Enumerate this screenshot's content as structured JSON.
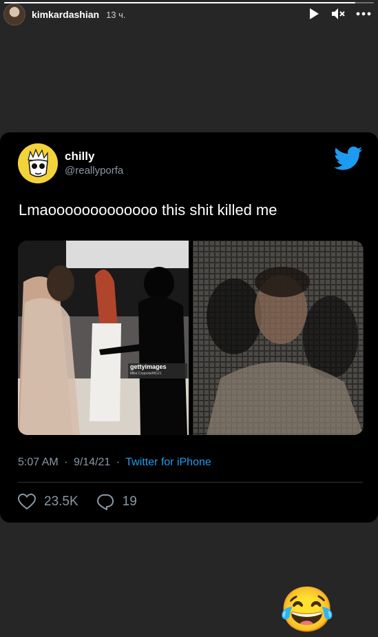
{
  "story": {
    "progress_fraction": 0.95,
    "username": "kimkardashian",
    "time_ago": "13 ч."
  },
  "header_icons": [
    "play-icon",
    "mute-icon",
    "more-icon"
  ],
  "tweet": {
    "display_name": "chilly",
    "handle": "@reallyporfa",
    "text": "Lmaooooooooooooo this shit killed me",
    "watermark_brand": "gettyimages",
    "watermark_credit": "Mike Coppola/MG21",
    "time": "5:07 AM",
    "date": "9/14/21",
    "separator": "·",
    "source": "Twitter for iPhone",
    "likes": "23.5K",
    "replies": "19"
  },
  "sticker": "😂",
  "colors": {
    "background": "#262626",
    "card": "#000000",
    "twitter_blue": "#1d9bf0",
    "meta_gray": "#8b98a5"
  }
}
